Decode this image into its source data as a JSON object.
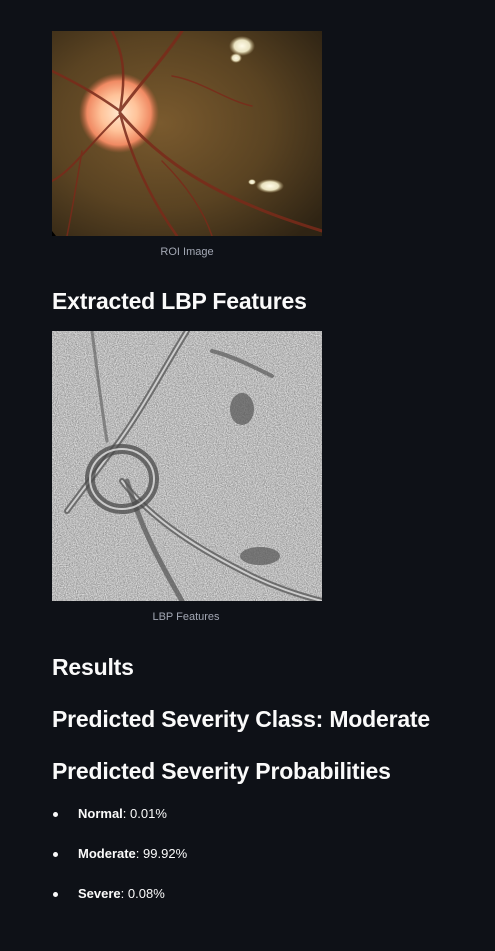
{
  "roi": {
    "caption": "ROI Image"
  },
  "lbp": {
    "heading": "Extracted LBP Features",
    "caption": "LBP Features"
  },
  "results": {
    "heading": "Results",
    "predicted_class": "Predicted Severity Class: Moderate",
    "probabilities_heading": "Predicted Severity Probabilities",
    "probabilities": [
      {
        "label": "Normal",
        "sep": ":",
        "value": " 0.01%"
      },
      {
        "label": "Moderate",
        "sep": ":",
        "value": " 99.92%"
      },
      {
        "label": "Severe",
        "sep": ":",
        "value": " 0.08%"
      }
    ]
  },
  "colors": {
    "background": "#0e1117",
    "text": "#fafafa",
    "caption": "#a3a8b4"
  }
}
